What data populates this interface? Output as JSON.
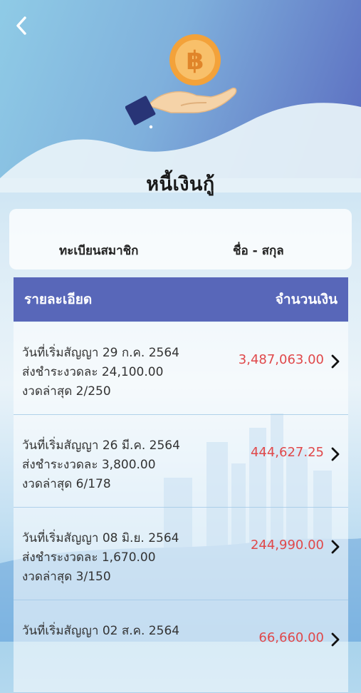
{
  "page": {
    "title": "หนี้เงินกู้"
  },
  "member": {
    "id_label": "ทะเบียนสมาชิก",
    "name_label": "ชื่อ - สกุล"
  },
  "table": {
    "col_details": "รายละเอียด",
    "col_amount": "จำนวนเงิน"
  },
  "loans": [
    {
      "start": "วันที่เริ่มสัญญา 29 ก.ค. 2564",
      "installment": "ส่งชำระงวดละ 24,100.00",
      "period": "งวดล่าสุด 2/250",
      "amount": "3,487,063.00"
    },
    {
      "start": "วันที่เริ่มสัญญา 26 มี.ค. 2564",
      "installment": "ส่งชำระงวดละ 3,800.00",
      "period": "งวดล่าสุด 6/178",
      "amount": "444,627.25"
    },
    {
      "start": "วันที่เริ่มสัญญา 08 มิ.ย. 2564",
      "installment": "ส่งชำระงวดละ 1,670.00",
      "period": "งวดล่าสุด 3/150",
      "amount": "244,990.00"
    },
    {
      "start": "วันที่เริ่มสัญญา 02 ส.ค. 2564",
      "installment": "",
      "period": "",
      "amount": "66,660.00"
    }
  ],
  "icons": {
    "back": "chevron-left-icon",
    "hero": "hand-coin-icon",
    "coin_symbol": "฿",
    "row_arrow": "chevron-right-icon"
  },
  "colors": {
    "header_bar": "#5867b9",
    "amount": "#e0484a",
    "coin": "#f3a23a"
  }
}
